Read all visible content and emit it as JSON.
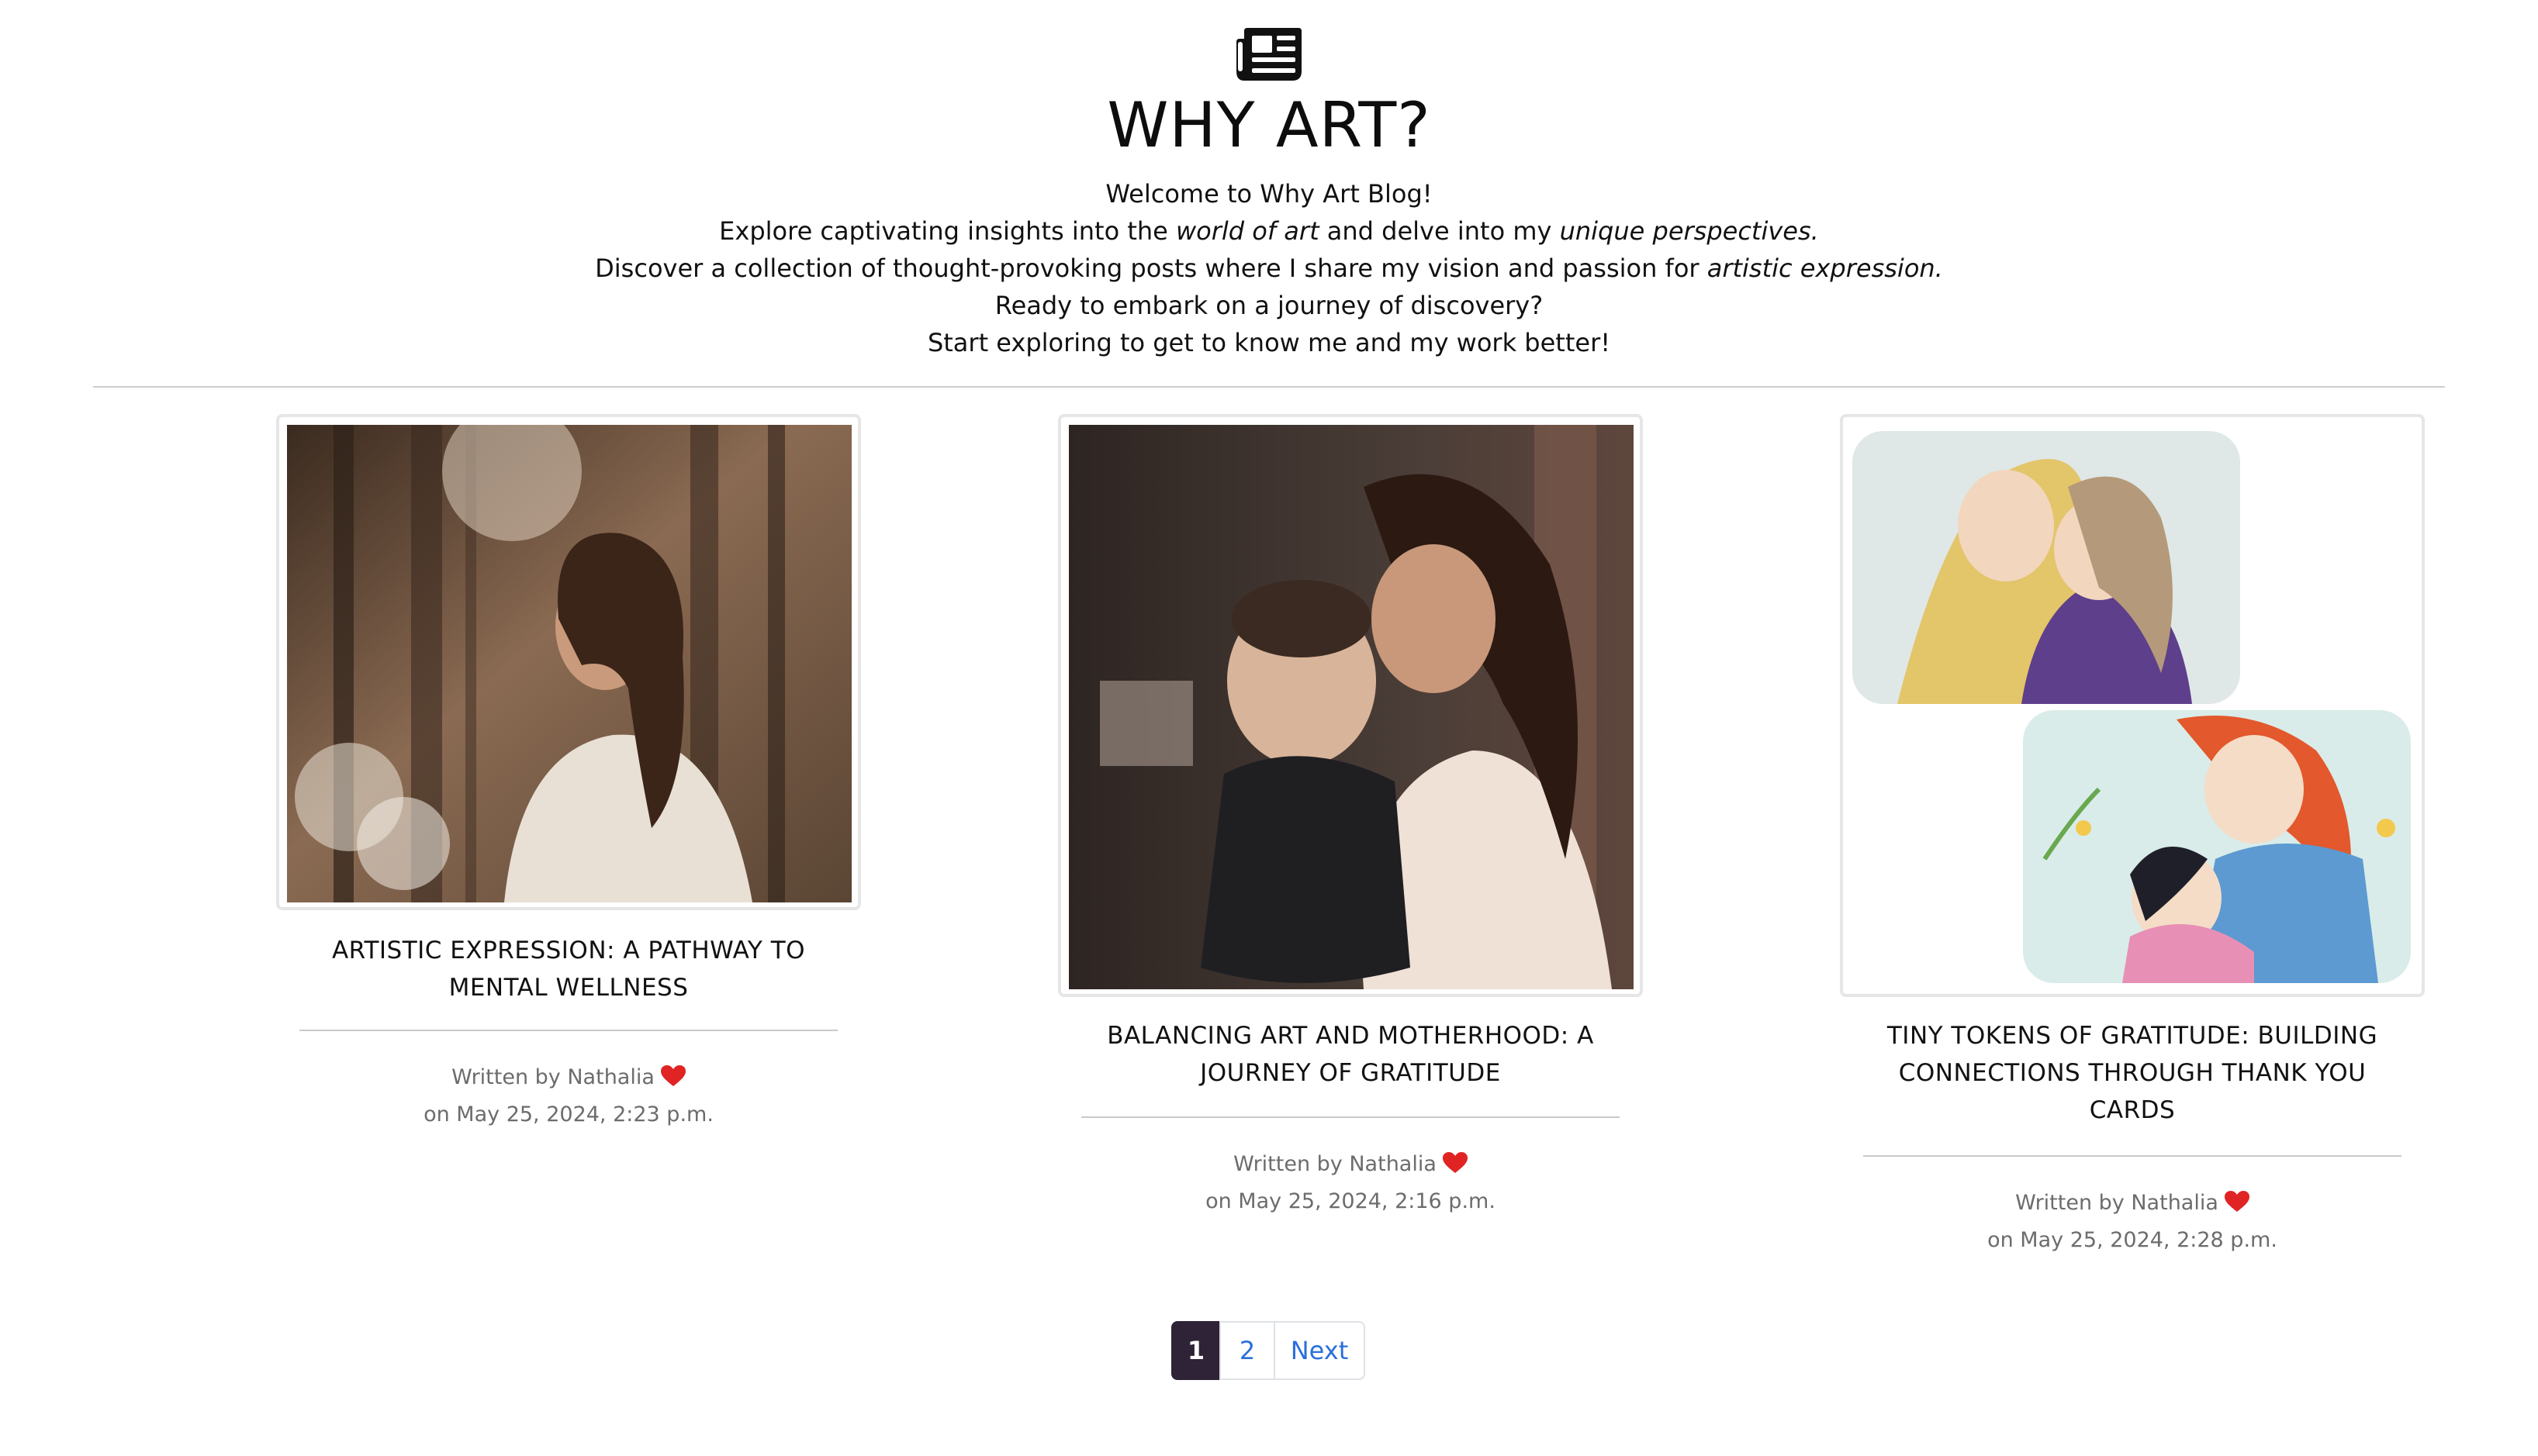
{
  "header": {
    "logo_icon": "newspaper-icon",
    "title": "WHY ART?",
    "intro": {
      "line1": "Welcome to Why Art Blog!",
      "line2_a": "Explore captivating insights into the ",
      "line2_em1": "world of art",
      "line2_b": " and delve into my ",
      "line2_em2": "unique perspectives.",
      "line3_a": "Discover a collection of thought-provoking posts where I share my vision and passion for ",
      "line3_em": "artistic expression.",
      "line4": "Ready to embark on a journey of discovery?",
      "line5": "Start exploring to get to know me and my work better!"
    }
  },
  "posts": [
    {
      "title": "ARTISTIC EXPRESSION: A PATHWAY TO MENTAL WELLNESS",
      "author_line": "Written by Nathalia",
      "date_line": "on May 25, 2024, 2:23 p.m."
    },
    {
      "title": "BALANCING ART AND MOTHERHOOD: A JOURNEY OF GRATITUDE",
      "author_line": "Written by Nathalia",
      "date_line": "on May 25, 2024, 2:16 p.m."
    },
    {
      "title": "TINY TOKENS OF GRATITUDE: BUILDING CONNECTIONS THROUGH THANK YOU CARDS",
      "author_line": "Written by Nathalia",
      "date_line": "on May 25, 2024, 2:28 p.m."
    }
  ],
  "pagination": {
    "page1": "1",
    "page2": "2",
    "next": "Next",
    "active_page": 1
  },
  "colors": {
    "heart": "#e02424",
    "active_page_bg": "#2f2338",
    "link": "#2a6fdb"
  }
}
